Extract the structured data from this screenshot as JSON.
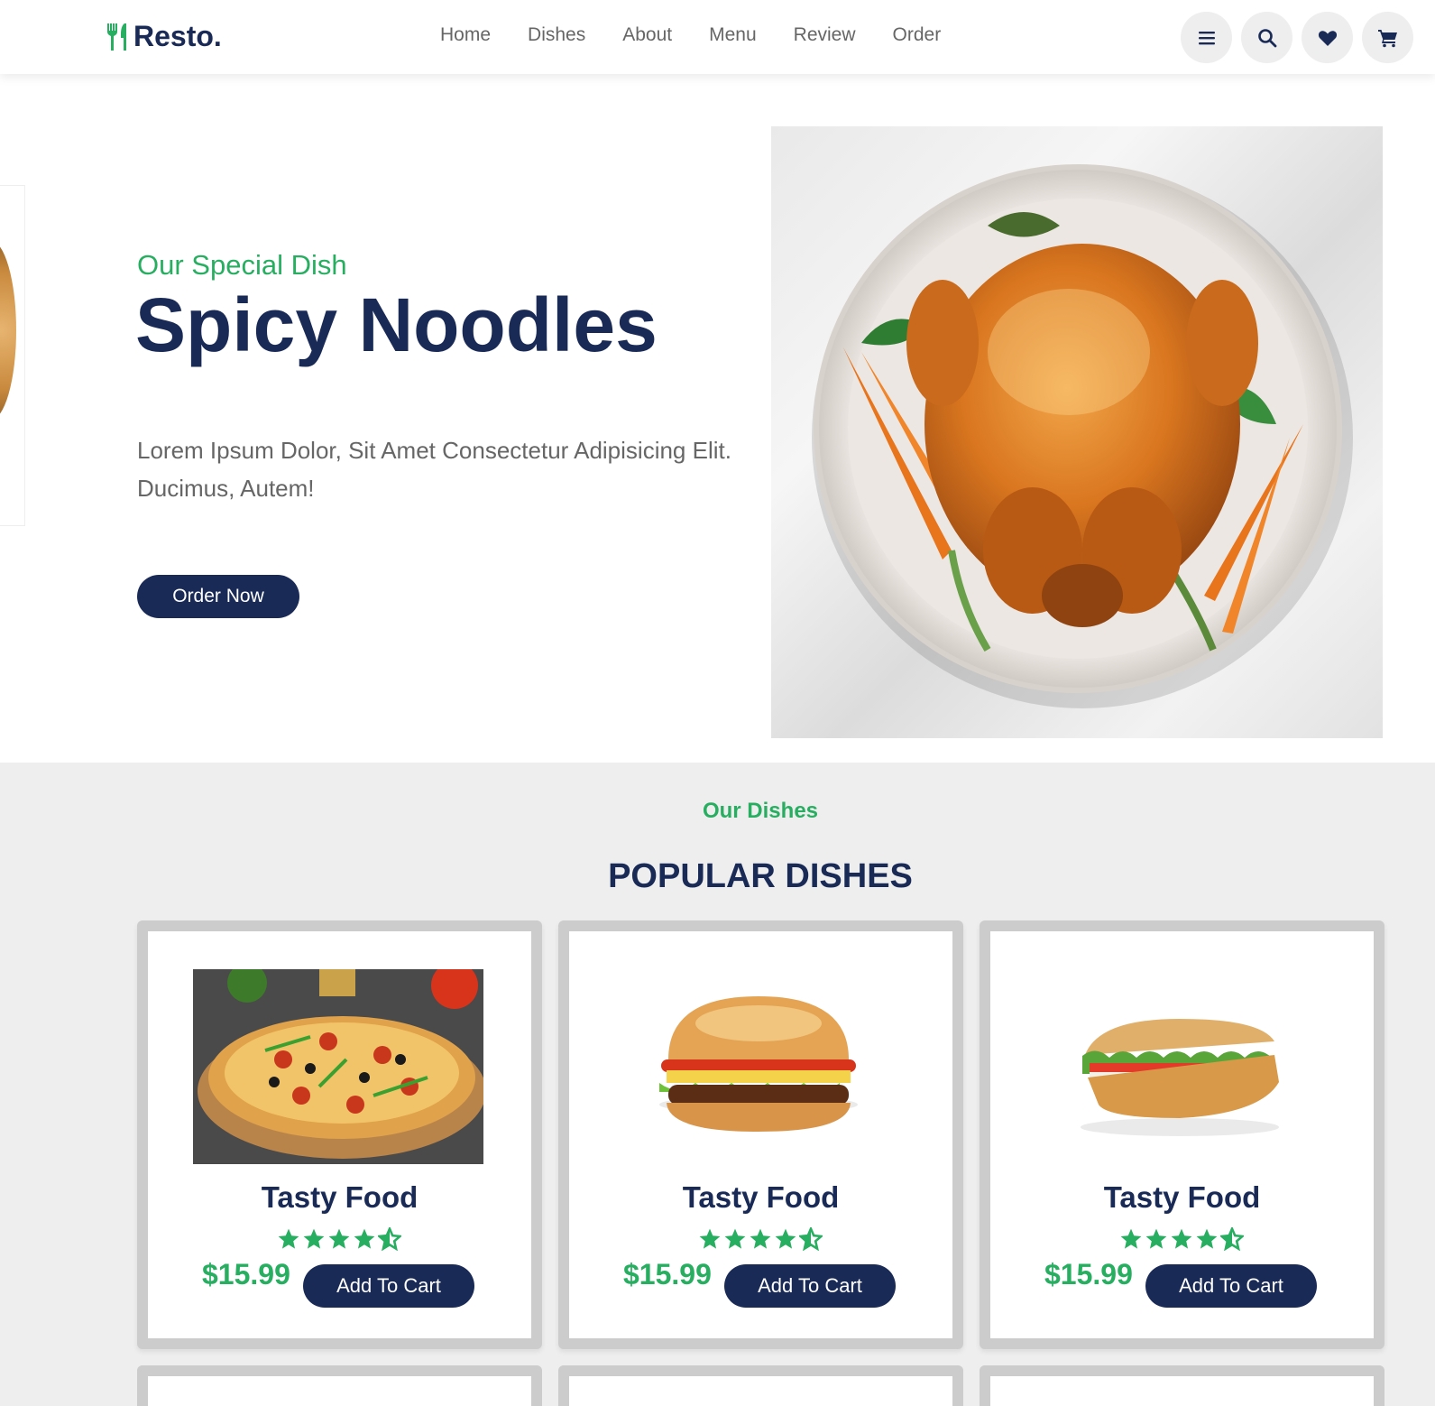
{
  "header": {
    "logo_text": "Resto.",
    "nav": [
      "Home",
      "Dishes",
      "About",
      "Menu",
      "Review",
      "Order"
    ],
    "icons": [
      "menu-icon",
      "search-icon",
      "heart-icon",
      "cart-icon"
    ]
  },
  "hero": {
    "subtitle": "Our Special Dish",
    "title": "Spicy Noodles",
    "description": "Lorem Ipsum Dolor, Sit Amet Consectetur Adipisicing Elit. Ducimus, Autem!",
    "button": "Order Now"
  },
  "dishes": {
    "subtitle": "Our Dishes",
    "title": "POPULAR DISHES",
    "cards": [
      {
        "name": "Tasty Food",
        "price": "$15.99",
        "button": "Add To Cart",
        "rating": 4.5,
        "image": "pizza"
      },
      {
        "name": "Tasty Food",
        "price": "$15.99",
        "button": "Add To Cart",
        "rating": 4.5,
        "image": "burger"
      },
      {
        "name": "Tasty Food",
        "price": "$15.99",
        "button": "Add To Cart",
        "rating": 4.5,
        "image": "sandwich"
      }
    ]
  },
  "colors": {
    "primary": "#192a56",
    "accent": "#27ae60",
    "muted": "#666666",
    "section_bg": "#eeeeee"
  }
}
